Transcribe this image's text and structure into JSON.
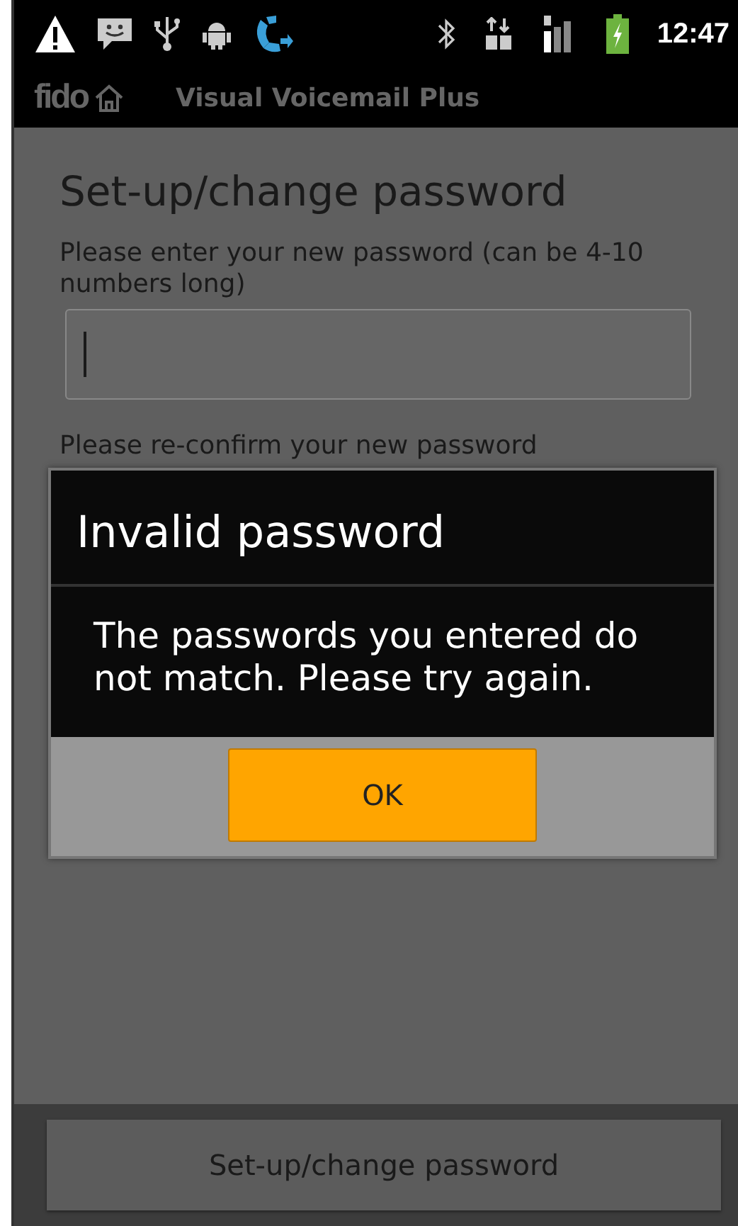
{
  "status_bar": {
    "time": "12:47"
  },
  "app_bar": {
    "logo": "fido",
    "title": "Visual Voicemail Plus"
  },
  "page": {
    "heading": "Set-up/change password",
    "password_field": {
      "label": "Please enter your new password (can be 4-10 numbers long)",
      "focused": true
    },
    "confirm_field": {
      "label": "Please re-confirm your new password"
    }
  },
  "dialog": {
    "title": "Invalid password",
    "message": "The passwords you entered do not match. Please try again.",
    "buttons": [
      "OK"
    ]
  },
  "bottom_button": "Set-up/change password"
}
